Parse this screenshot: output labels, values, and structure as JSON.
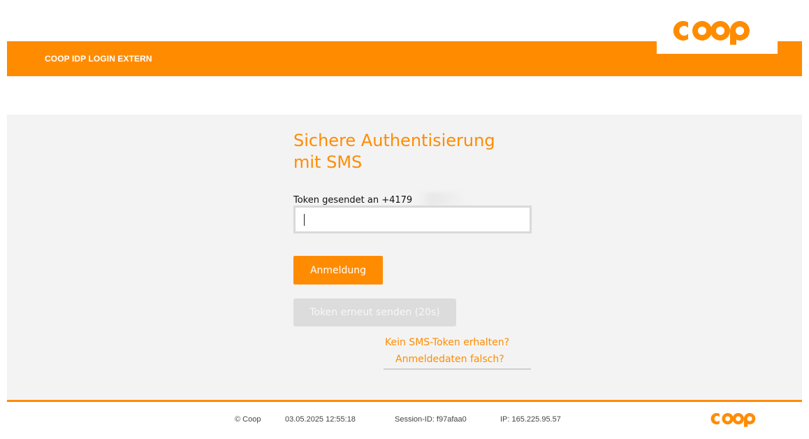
{
  "header": {
    "app_title": "COOP IDP LOGIN EXTERN",
    "logo_text": "coop",
    "accent_color": "#ff8c00"
  },
  "main": {
    "title_line1": "Sichere Authentisierung",
    "title_line2": "mit SMS",
    "token_label": "Token gesendet an +4179",
    "token_input": {
      "value": "",
      "placeholder": ""
    },
    "login_button": "Anmeldung",
    "resend_button": "Token erneut senden (20s)",
    "link_no_token": "Kein SMS-Token erhalten?",
    "link_wrong_credentials": "Anmeldedaten falsch?"
  },
  "footer": {
    "copyright": "© Coop",
    "timestamp": "03.05.2025 12:55:18",
    "session": "Session-ID: f97afaa0",
    "ip": "IP: 165.225.95.57",
    "logo_text": "coop"
  }
}
